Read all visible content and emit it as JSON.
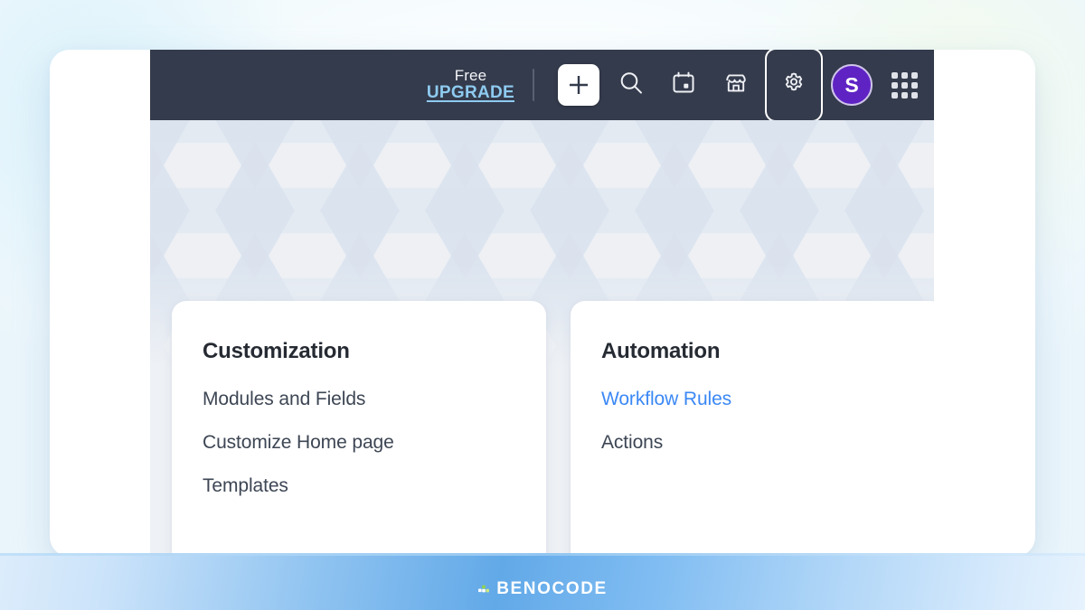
{
  "app": {
    "navbar": {
      "upgrade": {
        "plan_label": "Free",
        "action_label": "UPGRADE"
      },
      "icons": [
        {
          "name": "add-icon",
          "glyph": "plus"
        },
        {
          "name": "search-icon",
          "glyph": "magnifier"
        },
        {
          "name": "calendar-icon",
          "glyph": "calendar"
        },
        {
          "name": "marketplace-icon",
          "glyph": "store"
        },
        {
          "name": "settings-gear-icon",
          "glyph": "gear",
          "state": "selected"
        },
        {
          "name": "user-avatar",
          "glyph": "avatar",
          "initial": "S"
        },
        {
          "name": "apps-grid-icon",
          "glyph": "grid"
        }
      ],
      "avatar_initial": "S"
    },
    "cards": [
      {
        "title": "Customization",
        "links": [
          {
            "label": "Modules and Fields",
            "active": false
          },
          {
            "label": "Customize Home page",
            "active": false
          },
          {
            "label": "Templates",
            "active": false
          }
        ]
      },
      {
        "title": "Automation",
        "links": [
          {
            "label": "Workflow Rules",
            "active": true
          },
          {
            "label": "Actions",
            "active": false
          }
        ]
      }
    ]
  },
  "branding": {
    "watermark_text": "BENOCODE"
  },
  "colors": {
    "navbar_bg": "#343b4c",
    "upgrade_link": "#8ecbf0",
    "avatar_bg": "#5f23c4",
    "active_link": "#3b88f5",
    "card_bg": "#ffffff",
    "content_bg": "#eef1f5",
    "watermark_band": "#62a9e8"
  }
}
